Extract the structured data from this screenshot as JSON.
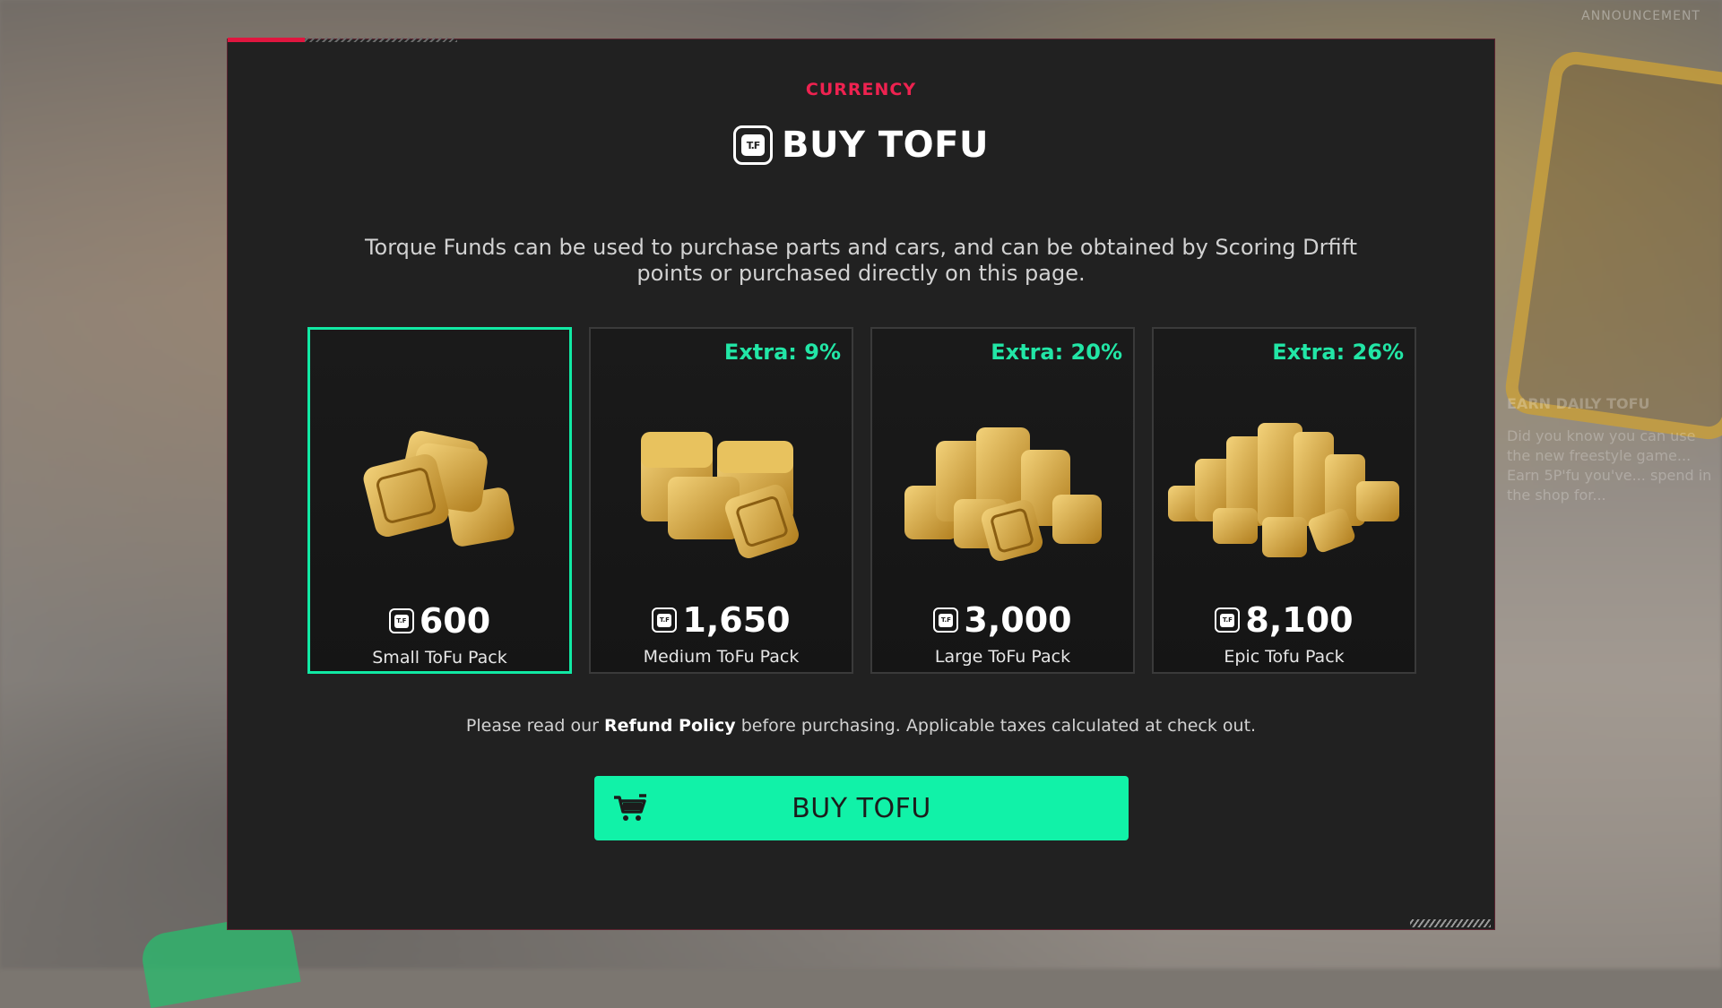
{
  "background": {
    "announcement": "ANNOUNCEMENT",
    "side_heading": "EARN DAILY TOFU",
    "side_text": "Did you know you can use the new freestyle game... Earn 5P'fu you've... spend in the shop for..."
  },
  "modal": {
    "eyebrow": "CURRENCY",
    "title": "BUY TOFU",
    "icon": "tofu-icon",
    "description": "Torque Funds can be used to purchase parts and cars, and can be obtained by Scoring Drfift points or purchased directly on this page.",
    "packs": [
      {
        "extra": "",
        "amount": "600",
        "name": "Small ToFu Pack",
        "selected": true
      },
      {
        "extra": "Extra: 9%",
        "amount": "1,650",
        "name": "Medium ToFu Pack",
        "selected": false
      },
      {
        "extra": "Extra: 20%",
        "amount": "3,000",
        "name": "Large ToFu Pack",
        "selected": false
      },
      {
        "extra": "Extra: 26%",
        "amount": "8,100",
        "name": "Epic Tofu Pack",
        "selected": false
      }
    ],
    "refund_prefix": "Please read our ",
    "refund_link": "Refund Policy",
    "refund_suffix": " before purchasing. Applicable taxes calculated at check out.",
    "buy_button": {
      "label": "BUY TOFU",
      "icon": "cart-icon"
    },
    "colors": {
      "accent": "#e0163f",
      "highlight": "#11e9a4",
      "button": "#11f2a8",
      "panel": "#212121"
    }
  }
}
